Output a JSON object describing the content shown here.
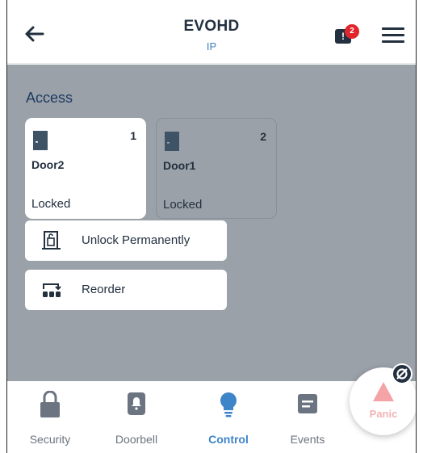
{
  "header": {
    "title": "EVOHD",
    "subtitle": "IP",
    "notification_count": "2",
    "notification_glyph": "!"
  },
  "main": {
    "section_title": "Access",
    "doors": [
      {
        "name": "Door2",
        "number": "1",
        "status": "Locked",
        "selected": true
      },
      {
        "name": "Door1",
        "number": "2",
        "status": "Locked",
        "selected": false
      }
    ],
    "actions": {
      "unlock_label": "Unlock Permanently",
      "reorder_label": "Reorder"
    }
  },
  "bottom_nav": {
    "items": [
      {
        "label": "Security",
        "icon": "lock-icon"
      },
      {
        "label": "Doorbell",
        "icon": "doorbell-icon"
      },
      {
        "label": "Control",
        "icon": "lightbulb-icon",
        "selected": true
      },
      {
        "label": "Events",
        "icon": "events-icon"
      }
    ],
    "panic_label": "Panic"
  },
  "colors": {
    "accent": "#3e84c9",
    "panel_grey": "#9ba1a8",
    "dark_text": "#22303f",
    "badge_red": "#e0262c"
  }
}
